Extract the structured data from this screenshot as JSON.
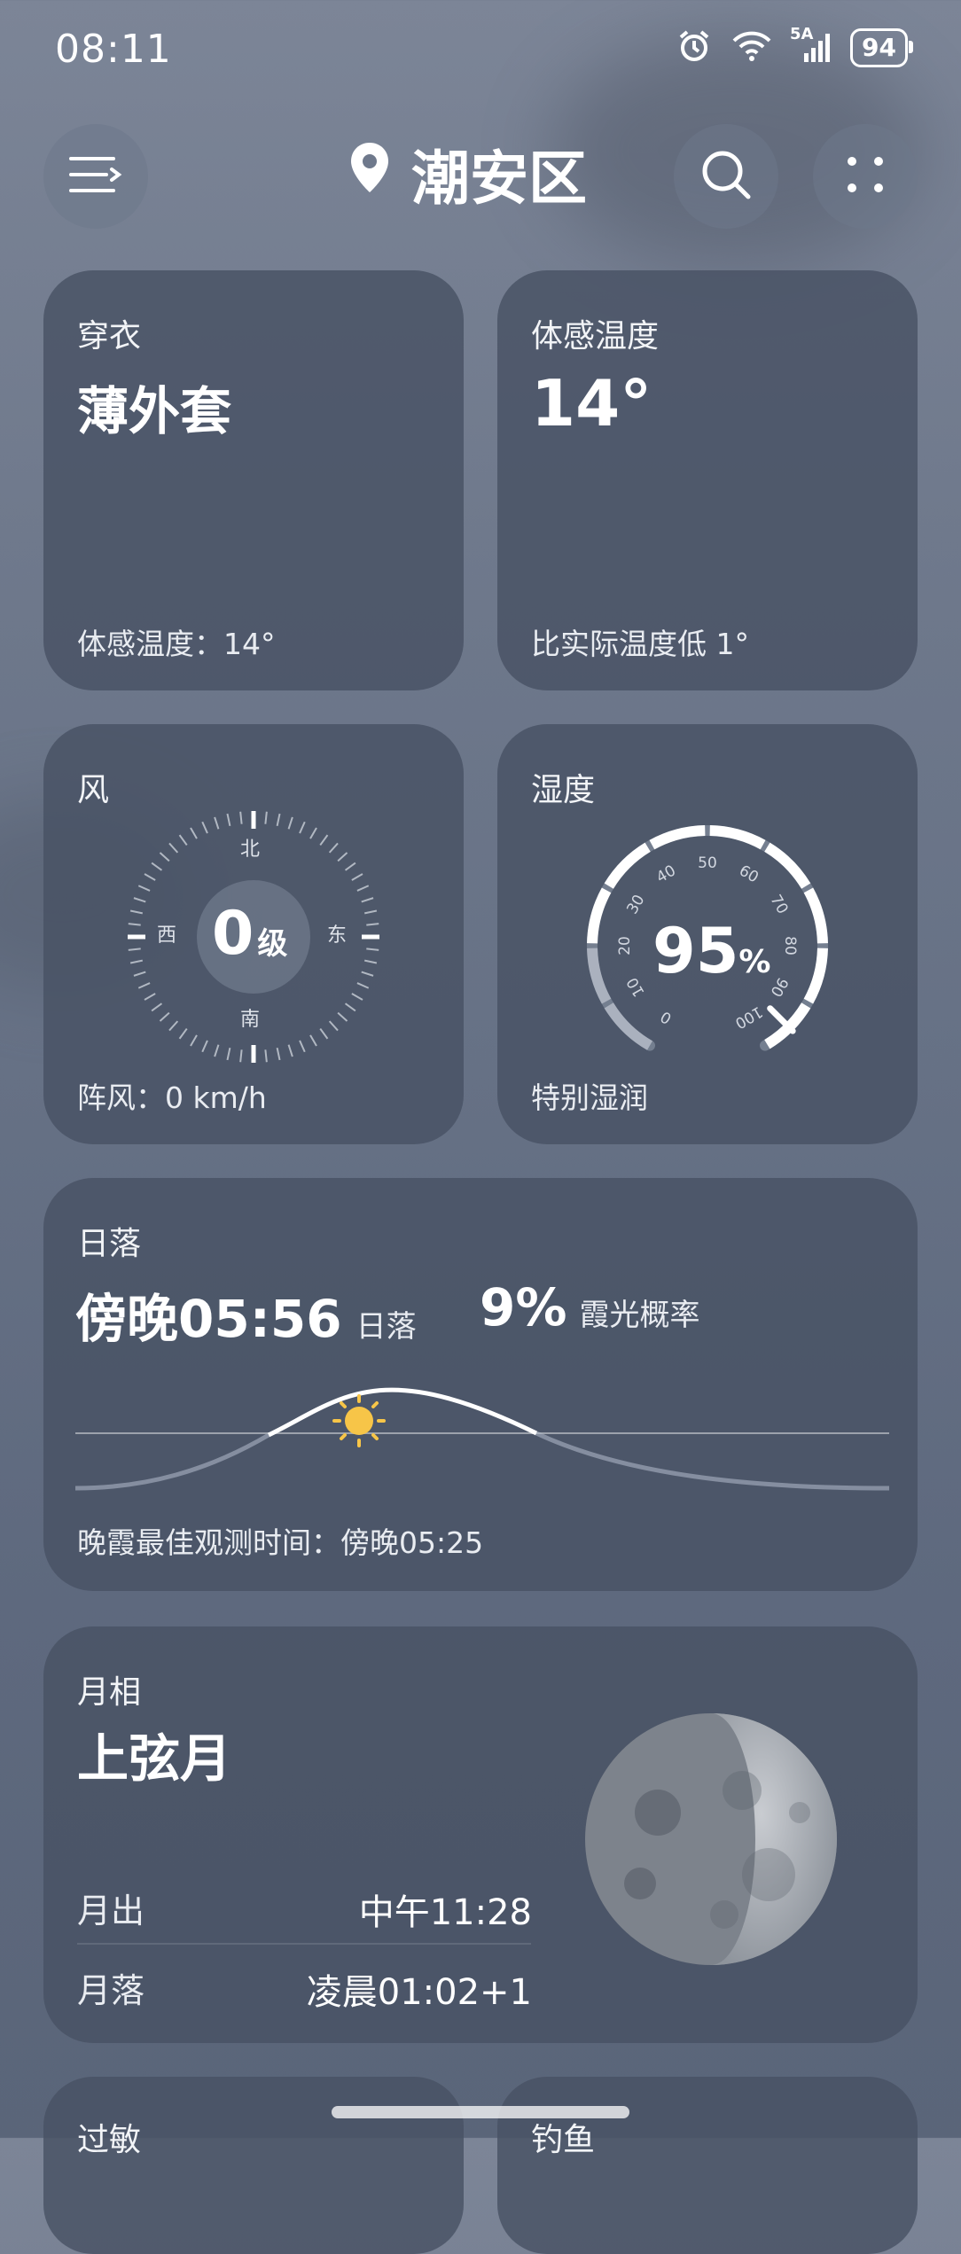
{
  "status": {
    "time": "08:11",
    "battery": "94",
    "net": "5A"
  },
  "header": {
    "location": "潮安区"
  },
  "clothing": {
    "title": "穿衣",
    "value": "薄外套",
    "sub_label": "体感温度：",
    "sub_value": "14°"
  },
  "feels_like": {
    "title": "体感温度",
    "value": "14°",
    "note": "比实际温度低 1°"
  },
  "wind": {
    "title": "风",
    "level": "0",
    "unit": "级",
    "dir_n": "北",
    "dir_s": "南",
    "dir_w": "西",
    "dir_e": "东",
    "gust": "阵风：0 km/h"
  },
  "humidity": {
    "title": "湿度",
    "value": "95",
    "unit": "%",
    "desc": "特别湿润",
    "level": 0.95,
    "ticks": [
      "0",
      "10",
      "20",
      "30",
      "40",
      "50",
      "60",
      "70",
      "80",
      "90",
      "100"
    ]
  },
  "sunset": {
    "title": "日落",
    "time": "傍晚05:56",
    "time_label": "日落",
    "glow": "9%",
    "glow_label": "霞光概率",
    "best": "晚霞最佳观测时间：傍晚05:25"
  },
  "moon": {
    "title": "月相",
    "phase": "上弦月",
    "rise_label": "月出",
    "rise": "中午11:28",
    "set_label": "月落",
    "set": "凌晨01:02+1"
  },
  "next": {
    "left_title": "过敏",
    "right_title": "钓鱼"
  },
  "colors": {
    "card": "#4a5466",
    "sun": "#f7c548",
    "accent_white": "#ffffff"
  }
}
